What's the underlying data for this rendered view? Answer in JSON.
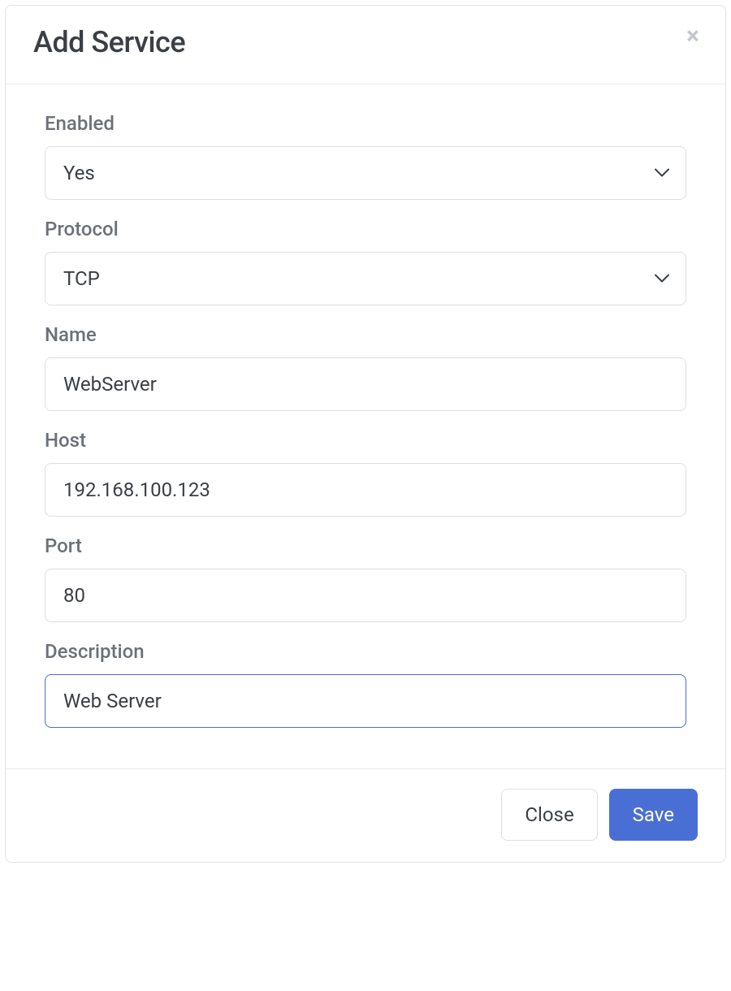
{
  "modal": {
    "title": "Add Service",
    "fields": {
      "enabled": {
        "label": "Enabled",
        "value": "Yes"
      },
      "protocol": {
        "label": "Protocol",
        "value": "TCP"
      },
      "name": {
        "label": "Name",
        "value": "WebServer"
      },
      "host": {
        "label": "Host",
        "value": "192.168.100.123"
      },
      "port": {
        "label": "Port",
        "value": "80"
      },
      "description": {
        "label": "Description",
        "value": "Web Server"
      }
    },
    "footer": {
      "close": "Close",
      "save": "Save"
    }
  }
}
